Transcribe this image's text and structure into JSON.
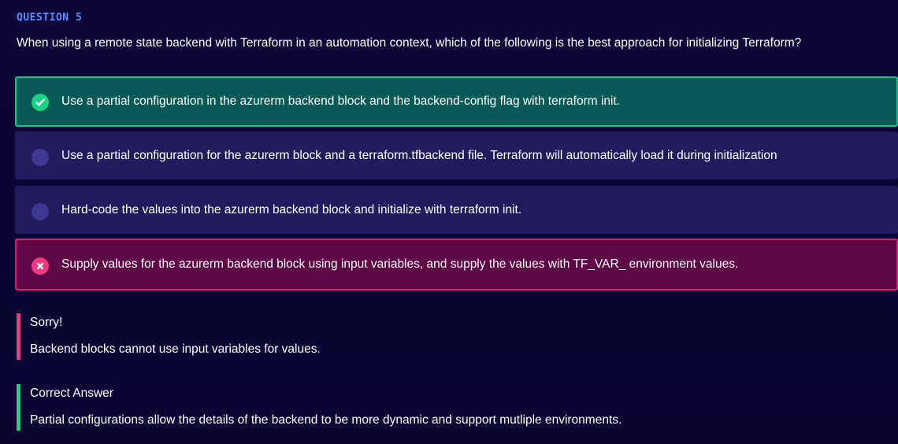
{
  "question": {
    "label": "QUESTION 5",
    "text": "When using a remote state backend with Terraform in an automation context, which of the following is the best approach for initializing Terraform?"
  },
  "options": [
    {
      "text": "Use a partial configuration in the azurerm backend block and the backend-config flag with terraform init.",
      "state": "correct",
      "icon": "check-circle-icon"
    },
    {
      "text": "Use a partial configuration for the azurerm block and a terraform.tfbackend file. Terraform will automatically load it during initialization",
      "state": "unselected",
      "icon": "radio-empty-icon"
    },
    {
      "text": "Hard-code the values into the azurerm backend block and initialize with terraform init.",
      "state": "unselected",
      "icon": "radio-empty-icon"
    },
    {
      "text": "Supply values for the azurerm backend block using input variables, and supply the values with TF_VAR_ environment values.",
      "state": "incorrect-selected",
      "icon": "x-circle-icon"
    }
  ],
  "feedback": {
    "sorry": {
      "title": "Sorry!",
      "text": "Backend blocks cannot use input variables for values."
    },
    "correct": {
      "title": "Correct Answer",
      "text": "Partial configurations allow the details of the backend to be more dynamic and support mutliple environments."
    }
  },
  "colors": {
    "background": "#0b0636",
    "question_label": "#5c8dff",
    "correct_bg": "#075a55",
    "correct_border": "#16c48a",
    "neutral_bg": "#221b5e",
    "wrong_bg": "#5f0646",
    "wrong_border": "#d4216e",
    "sorry_bar": "#f0377f",
    "correct_bar": "#17d386"
  }
}
